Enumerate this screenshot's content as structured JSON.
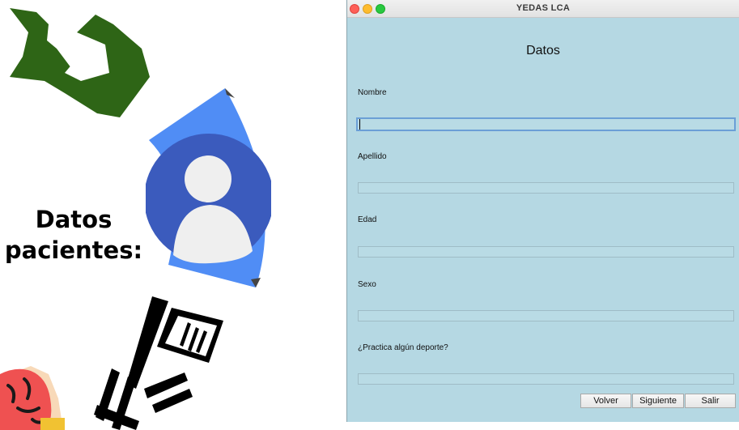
{
  "left_panel": {
    "title_line1": "Datos",
    "title_line2": "pacientes:",
    "icons": [
      "leg-brace-icon",
      "user-profile-icon",
      "test-document-icon",
      "brain-icon"
    ]
  },
  "window": {
    "title": "YEDAS LCA",
    "heading": "Datos",
    "fields": [
      {
        "label": "Nombre",
        "value": ""
      },
      {
        "label": "Apellido",
        "value": ""
      },
      {
        "label": "Edad",
        "value": ""
      },
      {
        "label": "Sexo",
        "value": ""
      },
      {
        "label": "¿Practica algún deporte?",
        "value": ""
      }
    ],
    "buttons": {
      "back": "Volver",
      "next": "Siguiente",
      "exit": "Salir"
    },
    "colors": {
      "window_background": "#b5d8e3",
      "focus_ring": "#6b9fd6",
      "close": "#fe5f57",
      "minimize": "#febc2e",
      "maximize": "#28c840"
    }
  }
}
